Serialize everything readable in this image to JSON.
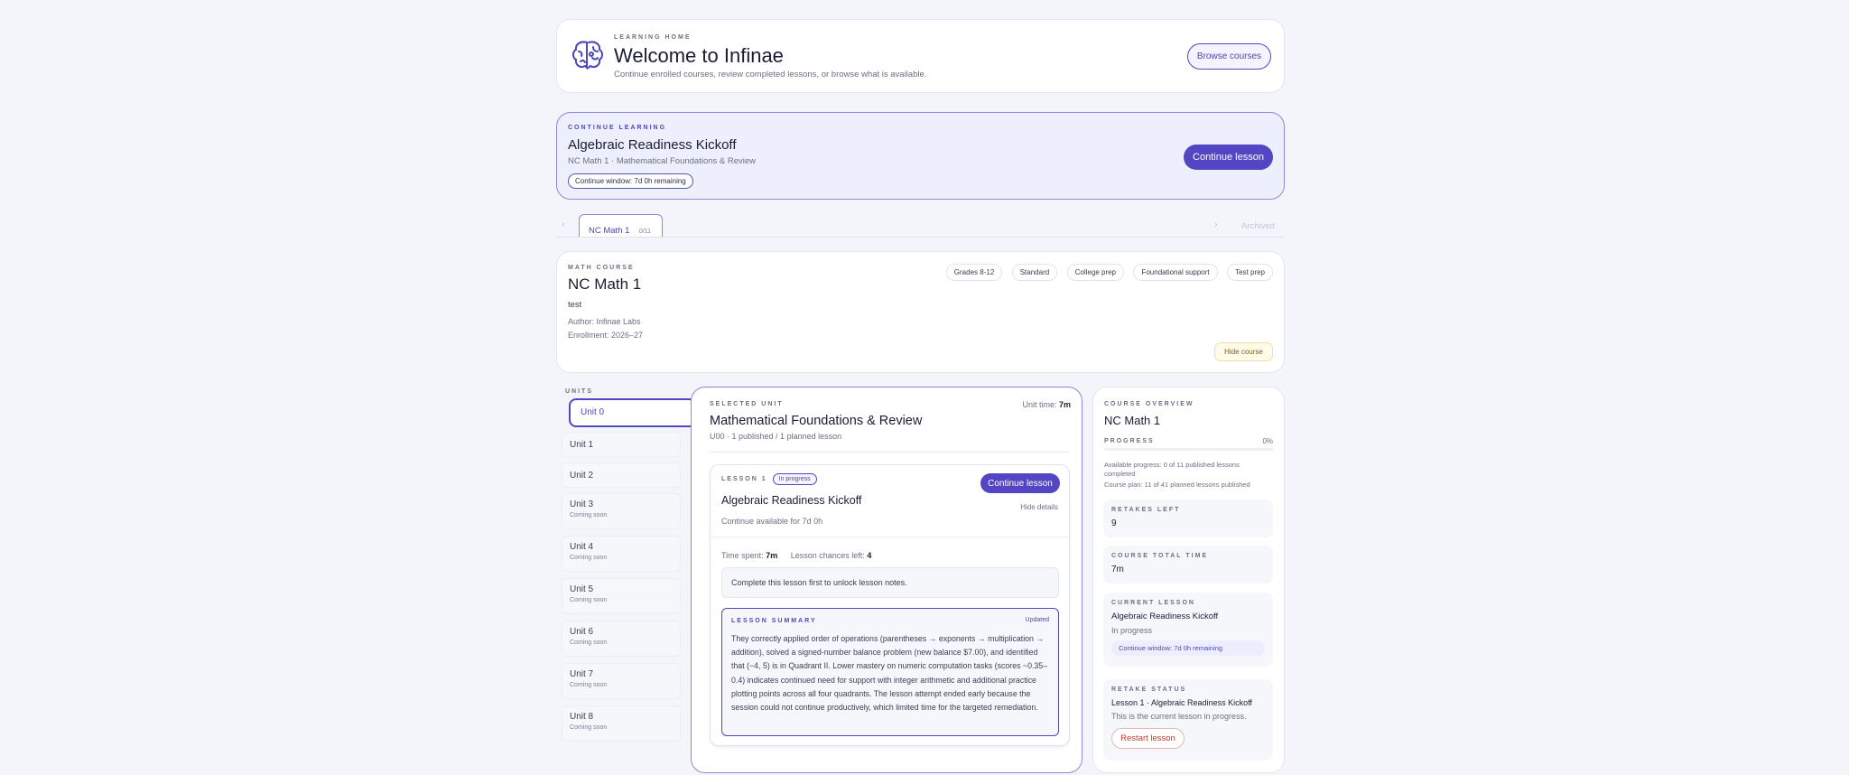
{
  "header": {
    "eyebrow": "LEARNING HOME",
    "title": "Welcome to Infinae",
    "subtitle": "Continue enrolled courses, review completed lessons, or browse what is available.",
    "browse_label": "Browse courses",
    "logo_icon": "brain-icon"
  },
  "continue_card": {
    "eyebrow": "CONTINUE LEARNING",
    "title": "Algebraic Readiness Kickoff",
    "subtitle": "NC Math 1 · Mathematical Foundations & Review",
    "window_pill": "Continue window: 7d 0h remaining",
    "button_label": "Continue lesson"
  },
  "tabs": {
    "prev_icon": "chevron-left-icon",
    "next_icon": "chevron-right-icon",
    "active_label": "NC Math 1",
    "active_count": "0/11",
    "archived_label": "Archived"
  },
  "course": {
    "eyebrow": "MATH COURSE",
    "title": "NC Math 1",
    "description": "test",
    "author": "Author: Infinae Labs",
    "enrollment": "Enrollment: 2026–27",
    "tags": [
      "Grades 8-12",
      "Standard",
      "College prep",
      "Foundational support",
      "Test prep"
    ],
    "hide_label": "Hide course"
  },
  "units": {
    "heading": "UNITS",
    "items": [
      {
        "name": "Unit 0",
        "sub": ""
      },
      {
        "name": "Unit 1",
        "sub": ""
      },
      {
        "name": "Unit 2",
        "sub": ""
      },
      {
        "name": "Unit 3",
        "sub": "Coming soon"
      },
      {
        "name": "Unit 4",
        "sub": "Coming soon"
      },
      {
        "name": "Unit 5",
        "sub": "Coming soon"
      },
      {
        "name": "Unit 6",
        "sub": "Coming soon"
      },
      {
        "name": "Unit 7",
        "sub": "Coming soon"
      },
      {
        "name": "Unit 8",
        "sub": "Coming soon"
      }
    ]
  },
  "selected_unit": {
    "eyebrow": "SELECTED UNIT",
    "unit_time_label": "Unit time:",
    "unit_time_value": "7m",
    "title": "Mathematical Foundations & Review",
    "meta": "U00 · 1 published / 1 planned lesson"
  },
  "lesson": {
    "eyebrow": "LESSON 1",
    "status": "In progress",
    "title": "Algebraic Readiness Kickoff",
    "availability": "Continue available for 7d 0h",
    "button_label": "Continue lesson",
    "hide_details": "Hide details",
    "time_spent_label": "Time spent:",
    "time_spent_value": "7m",
    "chances_label": "Lesson chances left:",
    "chances_value": "4",
    "notes_locked": "Complete this lesson first to unlock lesson notes.",
    "summary_eyebrow": "LESSON SUMMARY",
    "summary_badge": "Updated",
    "summary_text": "They correctly applied order of operations (parentheses → exponents → multiplication → addition), solved a signed-number balance problem (new balance $7.00), and identified that (−4, 5) is in Quadrant II. Lower mastery on numeric computation tasks (scores ~0.35–0.4) indicates continued need for support with integer arithmetic and additional practice plotting points across all four quadrants. The lesson attempt ended early because the session could not continue productively, which limited time for the targeted remediation."
  },
  "overview": {
    "eyebrow": "COURSE OVERVIEW",
    "title": "NC Math 1",
    "progress_label": "PROGRESS",
    "progress_value": "0%",
    "progress_fraction": 0,
    "available_progress": "Available progress: 0 of 11 published lessons completed",
    "course_plan": "Course plan: 11 of 41 planned lessons published",
    "retakes_label": "RETAKES LEFT",
    "retakes_value": "9",
    "total_time_label": "COURSE TOTAL TIME",
    "total_time_value": "7m",
    "current_label": "CURRENT LESSON",
    "current_title": "Algebraic Readiness Kickoff",
    "current_status": "In progress",
    "current_window": "Continue window: 7d 0h remaining",
    "retake_label": "RETAKE STATUS",
    "retake_title": "Lesson 1 · Algebraic Readiness Kickoff",
    "retake_note": "This is the current lesson in progress.",
    "restart_label": "Restart lesson"
  },
  "colors": {
    "accent": "#5246c4",
    "background": "#f3f5fb",
    "continue_bg": "#eeeffc",
    "warning_bg": "#fffbea",
    "danger_text": "#c0392b"
  }
}
